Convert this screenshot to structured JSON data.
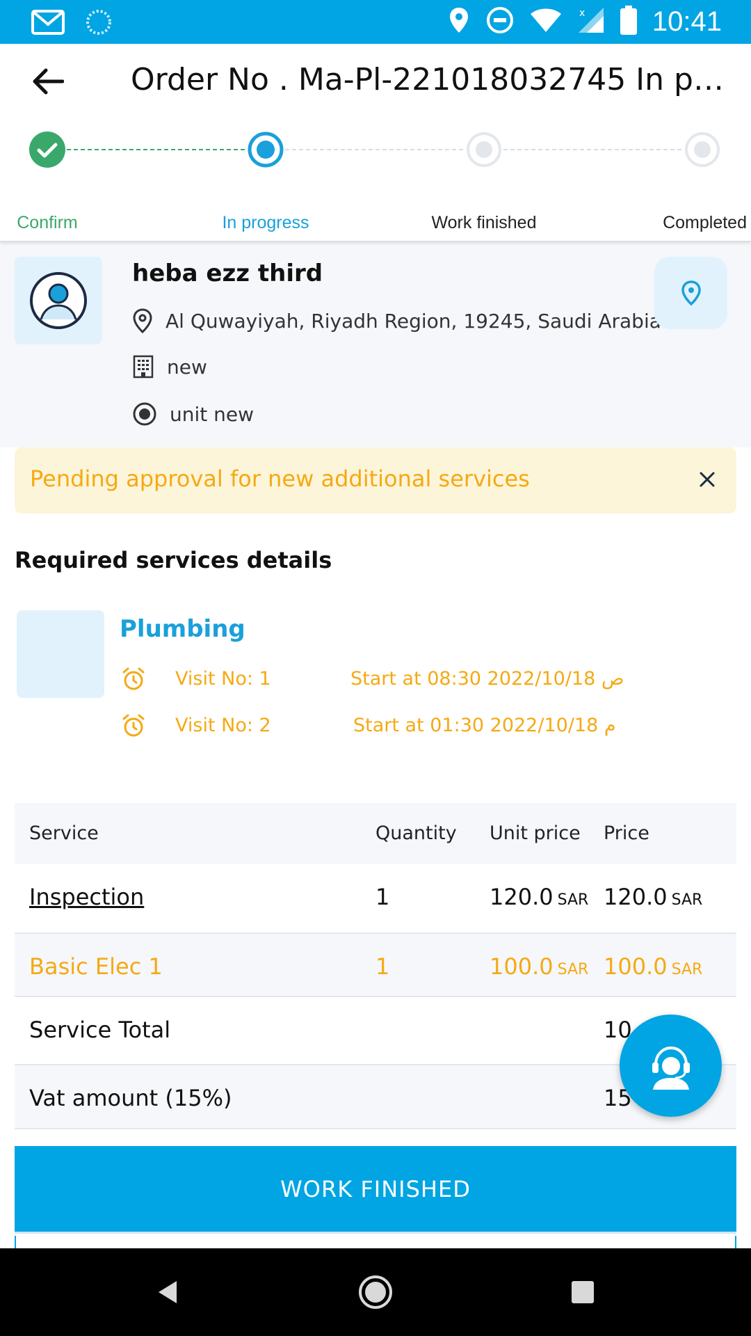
{
  "status_bar": {
    "time": "10:41"
  },
  "header": {
    "title": "Order No . Ma-Pl-221018032745 In pr..."
  },
  "stepper": {
    "steps": [
      {
        "label": "Confirm",
        "state": "done"
      },
      {
        "label": "In progress",
        "state": "current"
      },
      {
        "label": "Work finished",
        "state": "pending"
      },
      {
        "label": "Completed",
        "state": "pending"
      }
    ]
  },
  "customer": {
    "name": "heba ezz third",
    "address": "Al Quwayiyah, Riyadh Region, 19245, Saudi Arabia",
    "building": "new",
    "unit": "unit new"
  },
  "alert": {
    "text": "Pending approval for new additional services"
  },
  "required_services": {
    "title": "Required services details",
    "service_name": "Plumbing",
    "visits": [
      {
        "number": "Visit No: 1",
        "start": "Start at 08:30 2022/10/18 ص"
      },
      {
        "number": "Visit No: 2",
        "start": "Start at 01:30 2022/10/18 م"
      }
    ]
  },
  "table": {
    "headers": {
      "service": "Service",
      "quantity": "Quantity",
      "unit_price": "Unit price",
      "price": "Price"
    },
    "rows": [
      {
        "service": "Inspection",
        "quantity": "1",
        "unit_price": "120.0",
        "price": "120.0",
        "currency": "SAR"
      },
      {
        "service": "Basic Elec 1",
        "quantity": "1",
        "unit_price": "100.0",
        "price": "100.0",
        "currency": "SAR"
      }
    ],
    "service_total": {
      "label": "Service Total",
      "value": "10"
    },
    "vat": {
      "label": "Vat amount (15%)",
      "value": "15"
    }
  },
  "actions": {
    "primary": "WORK FINISHED"
  },
  "colors": {
    "primary": "#01a5e3",
    "success": "#3aa86b",
    "warning": "#f5a913",
    "card_bg": "#f5f7fb"
  },
  "icons": {
    "status_left": [
      "gmail-icon",
      "loading-icon"
    ],
    "status_right": [
      "location-icon",
      "dnd-icon",
      "wifi-icon",
      "signal-icon",
      "battery-icon"
    ],
    "fab": "support-agent-icon"
  }
}
